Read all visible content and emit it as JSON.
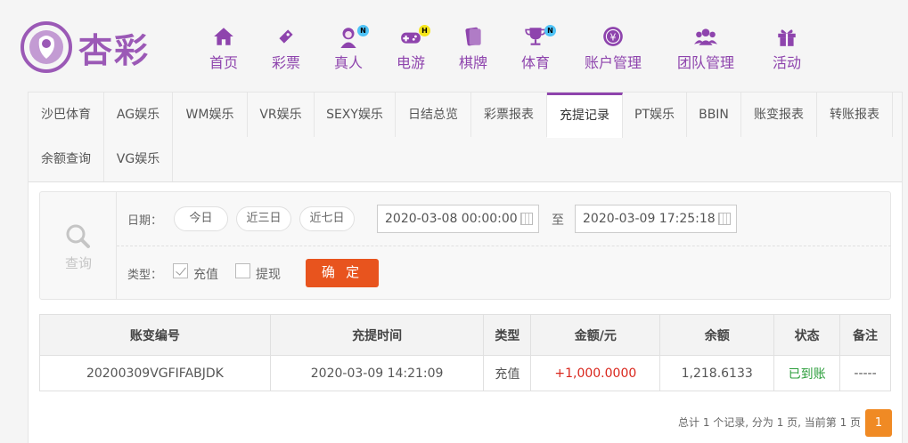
{
  "brand": {
    "name": "杏彩"
  },
  "nav": [
    {
      "label": "首页",
      "icon": "home-icon"
    },
    {
      "label": "彩票",
      "icon": "lottery-ticket-icon"
    },
    {
      "label": "真人",
      "icon": "live-dealer-icon",
      "badge": "N"
    },
    {
      "label": "电游",
      "icon": "gamepad-icon",
      "badge": "H"
    },
    {
      "label": "棋牌",
      "icon": "cards-icon"
    },
    {
      "label": "体育",
      "icon": "trophy-icon",
      "badge": "N"
    },
    {
      "label": "账户管理",
      "icon": "yen-coin-icon"
    },
    {
      "label": "团队管理",
      "icon": "team-icon"
    },
    {
      "label": "活动",
      "icon": "gift-icon"
    }
  ],
  "tabs": {
    "row1": [
      "沙巴体育",
      "AG娱乐",
      "WM娱乐",
      "VR娱乐",
      "SEXY娱乐",
      "日结总览",
      "彩票报表",
      "充提记录",
      "PT娱乐",
      "BBIN",
      "账变报表",
      "转账报表"
    ],
    "row2": [
      "余额查询",
      "VG娱乐"
    ],
    "active": "充提记录"
  },
  "filter": {
    "query_label": "查询",
    "date_label": "日期：",
    "quick": [
      "今日",
      "近三日",
      "近七日"
    ],
    "start": "2020-03-08 00:00:00",
    "to": "至",
    "end": "2020-03-09 17:25:18",
    "type_label": "类型：",
    "types": [
      {
        "label": "充值",
        "checked": true
      },
      {
        "label": "提现",
        "checked": false
      }
    ],
    "confirm": "确 定"
  },
  "table": {
    "headers": [
      "账变编号",
      "充提时间",
      "类型",
      "金额/元",
      "余额",
      "状态",
      "备注"
    ],
    "rows": [
      [
        "20200309VGFIFABJDK",
        "2020-03-09 14:21:09",
        "充值",
        "+1,000.0000",
        "1,218.6133",
        "已到账",
        "-----"
      ]
    ]
  },
  "pagination": {
    "summary": "总计 1 个记录, 分为 1 页, 当前第 1 页",
    "current": "1"
  },
  "colors": {
    "brand": "#8e44ad",
    "accent": "#e8541e",
    "page": "#f08a24",
    "amount": "#d9261c",
    "status_ok": "#2a9d3a"
  }
}
